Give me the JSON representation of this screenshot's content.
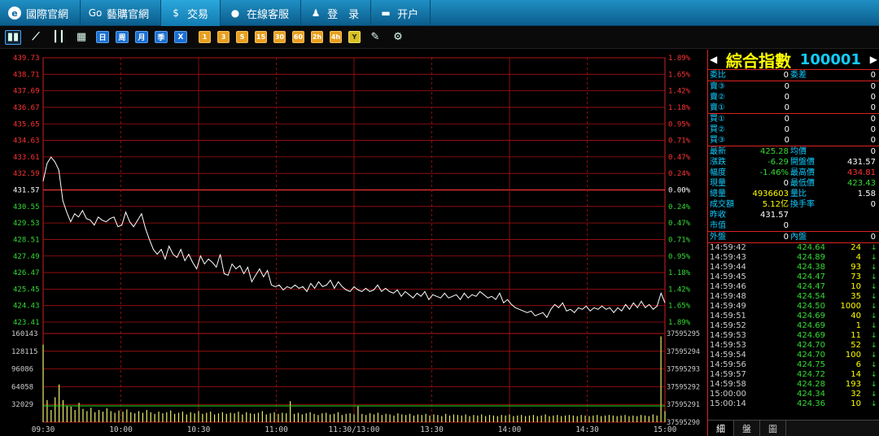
{
  "nav": [
    {
      "label": "國際官網",
      "icon": "e-logo-icon",
      "glyph": "e",
      "round": true
    },
    {
      "label": "藝購官網",
      "icon": "go-logo-icon",
      "glyph": "Go",
      "round": false
    },
    {
      "label": "交易",
      "icon": "dollar-icon",
      "glyph": "$",
      "round": false,
      "active": true
    },
    {
      "label": "在線客服",
      "icon": "chat-icon",
      "glyph": "●",
      "round": false
    },
    {
      "label": "登　录",
      "icon": "user-icon",
      "glyph": "♟",
      "round": false
    },
    {
      "label": "开户",
      "icon": "monitor-icon",
      "glyph": "▬",
      "round": false
    }
  ],
  "toolbar": {
    "icons": [
      "bar-chart-icon",
      "line-chart-icon",
      "candlestick-icon",
      "calendar-icon"
    ],
    "periods_blue": [
      "日",
      "周",
      "月",
      "季",
      "X"
    ],
    "periods_orange": [
      "1",
      "3",
      "5",
      "15",
      "30",
      "60",
      "2h",
      "4h"
    ],
    "period_yellow": "Y",
    "end_icons": [
      "pencil-icon",
      "gear-icon"
    ]
  },
  "chart_data": {
    "type": "line",
    "price_axis": [
      "439.73",
      "438.71",
      "437.69",
      "436.67",
      "435.65",
      "434.63",
      "433.61",
      "432.59",
      "431.57",
      "430.55",
      "429.53",
      "428.51",
      "427.49",
      "426.47",
      "425.45",
      "424.43",
      "423.41"
    ],
    "pct_axis": [
      "1.89%",
      "1.65%",
      "1.42%",
      "1.18%",
      "0.95%",
      "0.71%",
      "0.47%",
      "0.24%",
      "0.00%",
      "0.24%",
      "0.47%",
      "0.71%",
      "0.95%",
      "1.18%",
      "1.42%",
      "1.65%",
      "1.89%"
    ],
    "ylim": [
      423.41,
      439.73
    ],
    "prev_close": 431.57,
    "vol_axis_left": [
      "160143",
      "128115",
      "96086",
      "64058",
      "32029"
    ],
    "vol_axis_right": [
      "37595295",
      "37595294",
      "37595293",
      "37595292",
      "37595291",
      "37595290"
    ],
    "vol_max": 160143,
    "time_labels": [
      "09:30",
      "10:00",
      "10:30",
      "11:00",
      "11:30/13:00",
      "13:30",
      "14:00",
      "14:30",
      "15:00"
    ],
    "price_series": [
      432.1,
      433.2,
      433.6,
      433.3,
      432.8,
      430.9,
      430.2,
      429.6,
      430.1,
      429.9,
      430.3,
      429.8,
      429.7,
      429.4,
      429.9,
      429.7,
      429.6,
      429.8,
      429.9,
      429.3,
      429.4,
      430.2,
      429.6,
      429.3,
      429.7,
      430.1,
      429.2,
      428.5,
      427.9,
      427.6,
      427.9,
      427.3,
      428.1,
      427.6,
      427.4,
      427.9,
      427.2,
      427.6,
      427.1,
      426.7,
      427.5,
      427.0,
      427.3,
      427.1,
      426.8,
      427.6,
      426.4,
      426.3,
      427.0,
      426.7,
      426.9,
      426.4,
      426.8,
      425.9,
      426.3,
      426.7,
      426.2,
      426.6,
      425.7,
      425.6,
      425.7,
      425.4,
      425.6,
      425.5,
      425.7,
      425.5,
      425.6,
      425.3,
      425.8,
      425.5,
      425.9,
      425.6,
      425.7,
      426.0,
      425.5,
      425.9,
      425.6,
      425.4,
      425.3,
      425.6,
      425.4,
      425.3,
      425.5,
      425.3,
      425.4,
      425.7,
      425.3,
      425.5,
      425.3,
      425.2,
      425.4,
      425.0,
      425.3,
      425.1,
      424.9,
      425.2,
      425.0,
      425.3,
      424.8,
      425.1,
      425.0,
      424.9,
      425.2,
      424.9,
      425.0,
      425.1,
      424.8,
      425.2,
      424.9,
      425.1,
      425.0,
      425.3,
      425.1,
      424.9,
      425.0,
      424.8,
      425.2,
      424.6,
      424.8,
      424.5,
      424.3,
      424.2,
      424.1,
      424.0,
      424.1,
      423.8,
      423.9,
      424.0,
      423.7,
      424.2,
      424.5,
      424.3,
      424.6,
      424.1,
      424.2,
      424.0,
      424.3,
      424.2,
      424.4,
      424.1,
      424.3,
      424.2,
      424.4,
      424.2,
      424.3,
      424.0,
      424.3,
      424.1,
      424.5,
      424.2,
      424.6,
      424.3,
      424.7,
      424.3,
      424.5,
      424.2,
      424.4,
      425.2,
      424.6
    ],
    "volume_series": [
      140000,
      40000,
      22000,
      45000,
      68000,
      40000,
      30000,
      28000,
      22000,
      35000,
      24000,
      20000,
      26000,
      18000,
      22000,
      19000,
      25000,
      20000,
      17000,
      21000,
      19000,
      23000,
      18000,
      16000,
      20000,
      17000,
      22000,
      18000,
      15000,
      19000,
      16000,
      18000,
      21000,
      15000,
      17000,
      19000,
      14000,
      18000,
      16000,
      20000,
      15000,
      17000,
      19000,
      14000,
      16000,
      18000,
      15000,
      17000,
      16000,
      19000,
      14000,
      18000,
      16000,
      15000,
      17000,
      20000,
      14000,
      16000,
      18000,
      15000,
      17000,
      16000,
      38000,
      15000,
      17000,
      14000,
      16000,
      18000,
      15000,
      13000,
      16000,
      17000,
      14000,
      15000,
      18000,
      13000,
      15000,
      16000,
      14000,
      30000,
      15000,
      13000,
      16000,
      14000,
      17000,
      13000,
      15000,
      14000,
      12000,
      16000,
      14000,
      13000,
      15000,
      12000,
      14000,
      13000,
      15000,
      12000,
      14000,
      13000,
      11000,
      15000,
      12000,
      14000,
      13000,
      12000,
      14000,
      11000,
      13000,
      12000,
      14000,
      11000,
      13000,
      12000,
      11000,
      13000,
      12000,
      14000,
      11000,
      12000,
      13000,
      11000,
      12000,
      13000,
      11000,
      12000,
      14000,
      11000,
      12000,
      13000,
      11000,
      12000,
      13000,
      12000,
      11000,
      13000,
      12000,
      11000,
      12000,
      13000,
      11000,
      12000,
      13000,
      12000,
      11000,
      12000,
      13000,
      11000,
      12000,
      11000,
      13000,
      12000,
      11000,
      14000,
      12000,
      155000,
      20000
    ]
  },
  "panel": {
    "title": "綜合指數",
    "code": "100001",
    "top": [
      {
        "l": "委比",
        "v": "0",
        "l2": "委差",
        "v2": "0"
      }
    ],
    "sell": [
      {
        "l": "賣③",
        "p": "0",
        "v": "0"
      },
      {
        "l": "賣②",
        "p": "0",
        "v": "0"
      },
      {
        "l": "賣①",
        "p": "0",
        "v": "0"
      }
    ],
    "buy": [
      {
        "l": "買①",
        "p": "0",
        "v": "0"
      },
      {
        "l": "買②",
        "p": "0",
        "v": "0"
      },
      {
        "l": "買③",
        "p": "0",
        "v": "0"
      }
    ],
    "stats": [
      {
        "l": "最新",
        "v": "425.28",
        "vc": "green",
        "l2": "均價",
        "v2": "0",
        "v2c": ""
      },
      {
        "l": "漲跌",
        "v": "-6.29",
        "vc": "green",
        "l2": "開盤價",
        "v2": "431.57",
        "v2c": ""
      },
      {
        "l": "幅度",
        "v": "-1.46%",
        "vc": "green",
        "l2": "最高價",
        "v2": "434.81",
        "v2c": "red"
      },
      {
        "l": "現量",
        "v": "0",
        "vc": "",
        "l2": "最低價",
        "v2": "423.43",
        "v2c": "green"
      },
      {
        "l": "總量",
        "v": "4936603",
        "vc": "yellow",
        "l2": "量比",
        "v2": "1.58",
        "v2c": ""
      },
      {
        "l": "成交額",
        "v": "5.12亿",
        "vc": "yellow",
        "l2": "換手率",
        "v2": "0",
        "v2c": ""
      },
      {
        "l": "昨收",
        "v": "431.57",
        "vc": "",
        "l2": "",
        "v2": "",
        "v2c": ""
      },
      {
        "l": "市值",
        "v": "0",
        "vc": "",
        "l2": "",
        "v2": "",
        "v2c": ""
      }
    ],
    "outer": {
      "l": "外盤",
      "v": "0",
      "l2": "內盤",
      "v2": "0"
    },
    "ticks": [
      {
        "t": "14:59:42",
        "p": "424.64",
        "v": "24"
      },
      {
        "t": "14:59:43",
        "p": "424.89",
        "v": "4"
      },
      {
        "t": "14:59:44",
        "p": "424.38",
        "v": "93"
      },
      {
        "t": "14:59:45",
        "p": "424.47",
        "v": "73"
      },
      {
        "t": "14:59:46",
        "p": "424.47",
        "v": "10"
      },
      {
        "t": "14:59:48",
        "p": "424.54",
        "v": "35"
      },
      {
        "t": "14:59:49",
        "p": "424.50",
        "v": "1000"
      },
      {
        "t": "14:59:51",
        "p": "424.69",
        "v": "40"
      },
      {
        "t": "14:59:52",
        "p": "424.69",
        "v": "1"
      },
      {
        "t": "14:59:53",
        "p": "424.69",
        "v": "11"
      },
      {
        "t": "14:59:53",
        "p": "424.70",
        "v": "52"
      },
      {
        "t": "14:59:54",
        "p": "424.70",
        "v": "100"
      },
      {
        "t": "14:59:56",
        "p": "424.75",
        "v": "6"
      },
      {
        "t": "14:59:57",
        "p": "424.72",
        "v": "14"
      },
      {
        "t": "14:59:58",
        "p": "424.28",
        "v": "193"
      },
      {
        "t": "15:00:00",
        "p": "424.34",
        "v": "32"
      },
      {
        "t": "15:00:14",
        "p": "424.36",
        "v": "10"
      }
    ],
    "tabs": [
      "細",
      "盤",
      "圖"
    ]
  }
}
